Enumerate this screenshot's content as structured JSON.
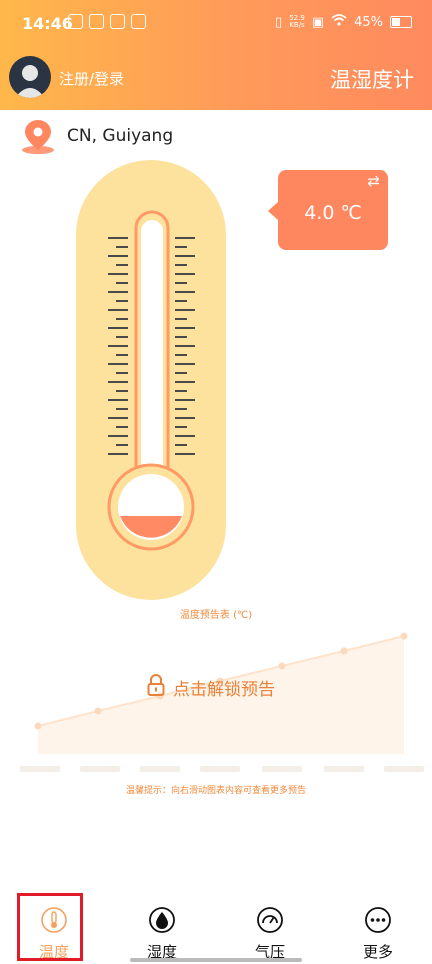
{
  "status_bar": {
    "time": "14:46",
    "net_speed_top": "52.9",
    "net_speed_bottom": "KB/s",
    "battery": "45%"
  },
  "header": {
    "login_label": "注册/登录",
    "app_title": "温湿度计"
  },
  "location": {
    "text": "CN, Guiyang",
    "icon": "location-pin-icon"
  },
  "reading": {
    "value": "4.0 ℃",
    "swap_icon": "⇄"
  },
  "forecast": {
    "title": "温度预告表 (℃)",
    "unlock_label": "点击解锁预告",
    "tip": "温馨提示：向右滑动图表内容可查看更多预告"
  },
  "tabs": [
    {
      "label": "温度",
      "icon": "thermometer-icon",
      "active": true
    },
    {
      "label": "湿度",
      "icon": "droplet-icon",
      "active": false
    },
    {
      "label": "气压",
      "icon": "gauge-icon",
      "active": false
    },
    {
      "label": "更多",
      "icon": "more-dots-icon",
      "active": false
    }
  ],
  "colors": {
    "accent": "#ff8760",
    "header_start": "#ffb74a",
    "header_end": "#ff8a5e",
    "thermo_body": "#fde29d",
    "active_tab": "#f5a05c"
  }
}
